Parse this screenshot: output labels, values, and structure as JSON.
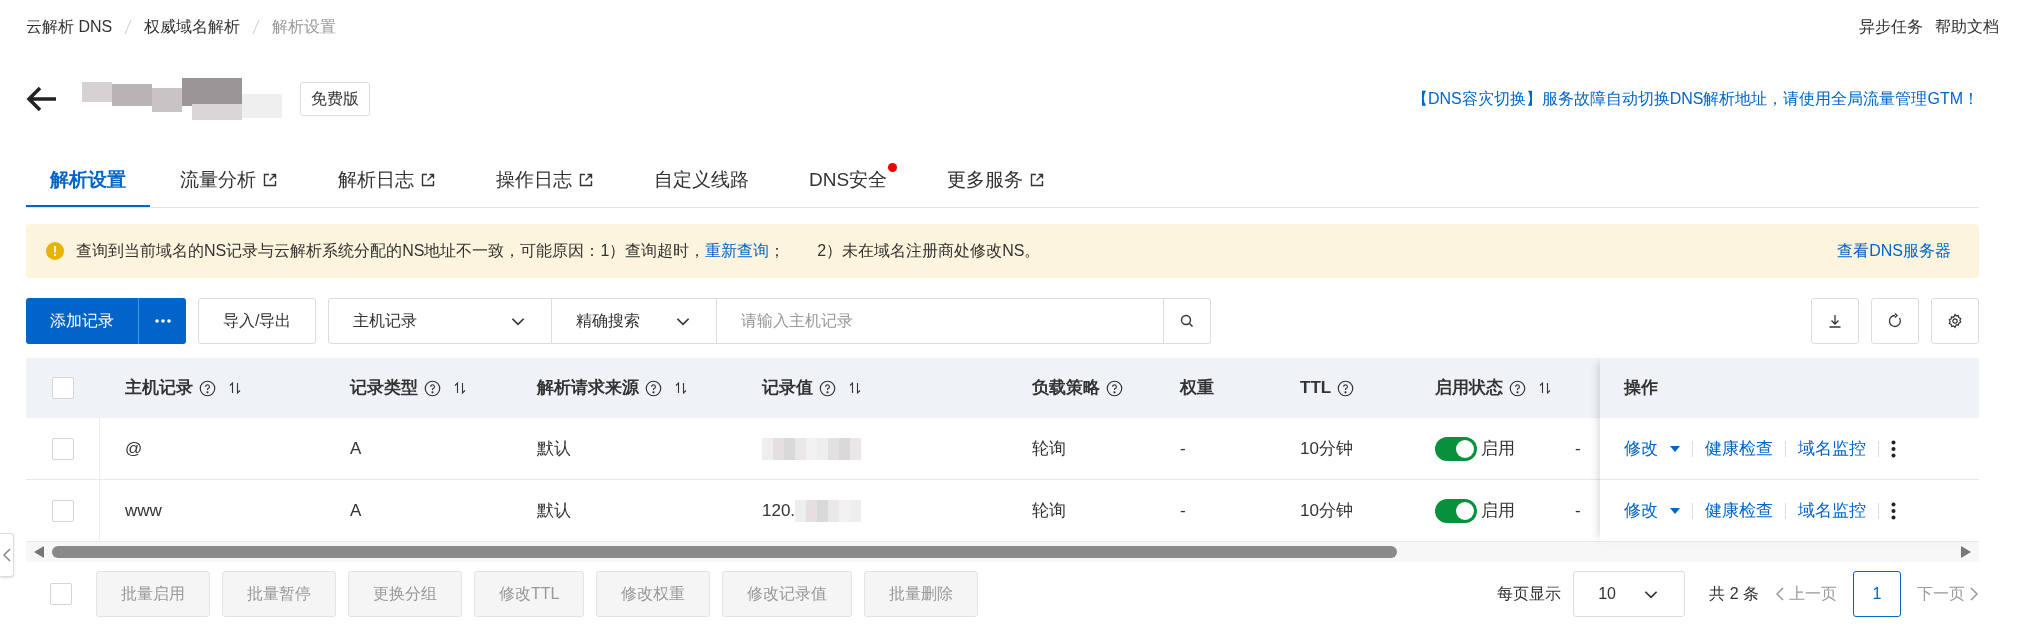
{
  "breadcrumb": [
    "云解析 DNS",
    "权威域名解析",
    "解析设置"
  ],
  "top_links": [
    "异步任务",
    "帮助文档"
  ],
  "header": {
    "edition_badge": "免费版",
    "promo_link": "【DNS容灾切换】服务故障自动切换DNS解析地址，请使用全局流量管理GTM！"
  },
  "tabs": [
    {
      "label": "解析设置",
      "selected": true,
      "external": false,
      "dot": false
    },
    {
      "label": "流量分析",
      "selected": false,
      "external": true,
      "dot": false
    },
    {
      "label": "解析日志",
      "selected": false,
      "external": true,
      "dot": false
    },
    {
      "label": "操作日志",
      "selected": false,
      "external": true,
      "dot": false
    },
    {
      "label": "自定义线路",
      "selected": false,
      "external": false,
      "dot": false
    },
    {
      "label": "DNS安全",
      "selected": false,
      "external": false,
      "dot": true
    },
    {
      "label": "更多服务",
      "selected": false,
      "external": true,
      "dot": false
    }
  ],
  "alert": {
    "text_before": "查询到当前域名的NS记录与云解析系统分配的NS地址不一致，可能原因：1）查询超时，",
    "link": "重新查询",
    "text_mid": "；",
    "text_after": "2）未在域名注册商处修改NS。",
    "action": "查看DNS服务器"
  },
  "toolbar": {
    "add_button": "添加记录",
    "import_export": "导入/导出",
    "filter_field": "主机记录",
    "match_mode": "精确搜索",
    "search_placeholder": "请输入主机记录"
  },
  "table": {
    "columns": [
      {
        "label": "主机记录",
        "help": true,
        "sortable": true
      },
      {
        "label": "记录类型",
        "help": true,
        "sortable": true
      },
      {
        "label": "解析请求来源",
        "help": true,
        "sortable": true
      },
      {
        "label": "记录值",
        "help": true,
        "sortable": true
      },
      {
        "label": "负载策略",
        "help": true,
        "sortable": false
      },
      {
        "label": "权重",
        "help": false,
        "sortable": false
      },
      {
        "label": "TTL",
        "help": true,
        "sortable": false
      },
      {
        "label": "启用状态",
        "help": true,
        "sortable": true
      }
    ],
    "actions_column": "操作",
    "select_all_checked": false,
    "rows": [
      {
        "checked": false,
        "host": "@",
        "type": "A",
        "source": "默认",
        "value": "",
        "policy": "轮询",
        "weight": "-",
        "ttl": "10分钟",
        "enabled": true,
        "status": "启用",
        "column_9": "-",
        "actions": [
          "修改",
          "健康检查",
          "域名监控"
        ]
      },
      {
        "checked": false,
        "host": "www",
        "type": "A",
        "source": "默认",
        "value": "120.",
        "policy": "轮询",
        "weight": "-",
        "ttl": "10分钟",
        "enabled": true,
        "status": "启用",
        "column_9": "-",
        "actions": [
          "修改",
          "健康检查",
          "域名监控"
        ]
      }
    ]
  },
  "bulk_select_checked": false,
  "bulk_actions": [
    {
      "label": "批量启用",
      "disabled": true
    },
    {
      "label": "批量暂停",
      "disabled": true
    },
    {
      "label": "更换分组",
      "disabled": true
    },
    {
      "label": "修改TTL",
      "disabled": true
    },
    {
      "label": "修改权重",
      "disabled": true
    },
    {
      "label": "修改记录值",
      "disabled": true
    },
    {
      "label": "批量删除",
      "disabled": true
    }
  ],
  "pagination": {
    "page_size_label": "每页显示",
    "page_size": "10",
    "total": "共 2 条",
    "prev": "上一页",
    "pages": [
      {
        "label": "1",
        "selected": true
      }
    ],
    "next": "下一页"
  }
}
